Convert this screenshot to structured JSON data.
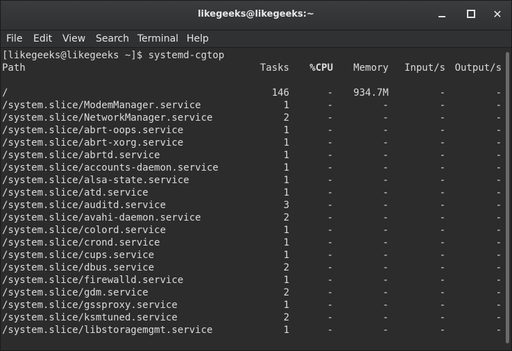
{
  "window": {
    "title": "likegeeks@likegeeks:~",
    "controls": {
      "minimize": "minimize",
      "maximize": "maximize",
      "close": "✕"
    }
  },
  "menu": [
    "File",
    "Edit",
    "View",
    "Search",
    "Terminal",
    "Help"
  ],
  "terminal": {
    "prompt": "[likegeeks@likegeeks ~]$ systemd-cgtop",
    "columns": {
      "path": "Path",
      "tasks": "Tasks",
      "cpu": "%CPU",
      "memory": "Memory",
      "input": "Input/s",
      "output": "Output/s"
    },
    "rows": [
      {
        "path": "/",
        "tasks": "146",
        "cpu": "-",
        "memory": "934.7M",
        "input": "-",
        "output": "-"
      },
      {
        "path": "/system.slice/ModemManager.service",
        "tasks": "1",
        "cpu": "-",
        "memory": "-",
        "input": "-",
        "output": "-"
      },
      {
        "path": "/system.slice/NetworkManager.service",
        "tasks": "2",
        "cpu": "-",
        "memory": "-",
        "input": "-",
        "output": "-"
      },
      {
        "path": "/system.slice/abrt-oops.service",
        "tasks": "1",
        "cpu": "-",
        "memory": "-",
        "input": "-",
        "output": "-"
      },
      {
        "path": "/system.slice/abrt-xorg.service",
        "tasks": "1",
        "cpu": "-",
        "memory": "-",
        "input": "-",
        "output": "-"
      },
      {
        "path": "/system.slice/abrtd.service",
        "tasks": "1",
        "cpu": "-",
        "memory": "-",
        "input": "-",
        "output": "-"
      },
      {
        "path": "/system.slice/accounts-daemon.service",
        "tasks": "1",
        "cpu": "-",
        "memory": "-",
        "input": "-",
        "output": "-"
      },
      {
        "path": "/system.slice/alsa-state.service",
        "tasks": "1",
        "cpu": "-",
        "memory": "-",
        "input": "-",
        "output": "-"
      },
      {
        "path": "/system.slice/atd.service",
        "tasks": "1",
        "cpu": "-",
        "memory": "-",
        "input": "-",
        "output": "-"
      },
      {
        "path": "/system.slice/auditd.service",
        "tasks": "3",
        "cpu": "-",
        "memory": "-",
        "input": "-",
        "output": "-"
      },
      {
        "path": "/system.slice/avahi-daemon.service",
        "tasks": "2",
        "cpu": "-",
        "memory": "-",
        "input": "-",
        "output": "-"
      },
      {
        "path": "/system.slice/colord.service",
        "tasks": "1",
        "cpu": "-",
        "memory": "-",
        "input": "-",
        "output": "-"
      },
      {
        "path": "/system.slice/crond.service",
        "tasks": "1",
        "cpu": "-",
        "memory": "-",
        "input": "-",
        "output": "-"
      },
      {
        "path": "/system.slice/cups.service",
        "tasks": "1",
        "cpu": "-",
        "memory": "-",
        "input": "-",
        "output": "-"
      },
      {
        "path": "/system.slice/dbus.service",
        "tasks": "2",
        "cpu": "-",
        "memory": "-",
        "input": "-",
        "output": "-"
      },
      {
        "path": "/system.slice/firewalld.service",
        "tasks": "1",
        "cpu": "-",
        "memory": "-",
        "input": "-",
        "output": "-"
      },
      {
        "path": "/system.slice/gdm.service",
        "tasks": "2",
        "cpu": "-",
        "memory": "-",
        "input": "-",
        "output": "-"
      },
      {
        "path": "/system.slice/gssproxy.service",
        "tasks": "1",
        "cpu": "-",
        "memory": "-",
        "input": "-",
        "output": "-"
      },
      {
        "path": "/system.slice/ksmtuned.service",
        "tasks": "2",
        "cpu": "-",
        "memory": "-",
        "input": "-",
        "output": "-"
      },
      {
        "path": "/system.slice/libstoragemgmt.service",
        "tasks": "1",
        "cpu": "-",
        "memory": "-",
        "input": "-",
        "output": "-"
      }
    ]
  }
}
